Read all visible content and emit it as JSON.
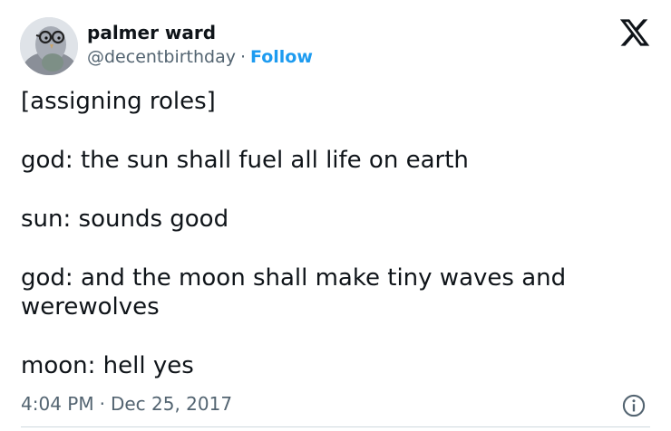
{
  "author": {
    "display_name": "palmer ward",
    "handle": "@decentbirthday",
    "separator": "·",
    "follow_label": "Follow",
    "avatar_icon": "pigeon-with-glasses-avatar"
  },
  "brand_icon": "x-logo-icon",
  "tweet": {
    "lines": [
      "[assigning roles]",
      "god: the sun shall fuel all life on earth",
      "sun: sounds good",
      "god: and the moon shall make tiny waves and werewolves",
      "moon: hell yes"
    ]
  },
  "meta": {
    "time": "4:04 PM",
    "separator": "·",
    "date": "Dec 25, 2017",
    "info_icon": "info-icon"
  },
  "colors": {
    "text": "#0f1419",
    "secondary": "#536471",
    "accent": "#1d9bf0",
    "divider": "#cfd9de"
  }
}
